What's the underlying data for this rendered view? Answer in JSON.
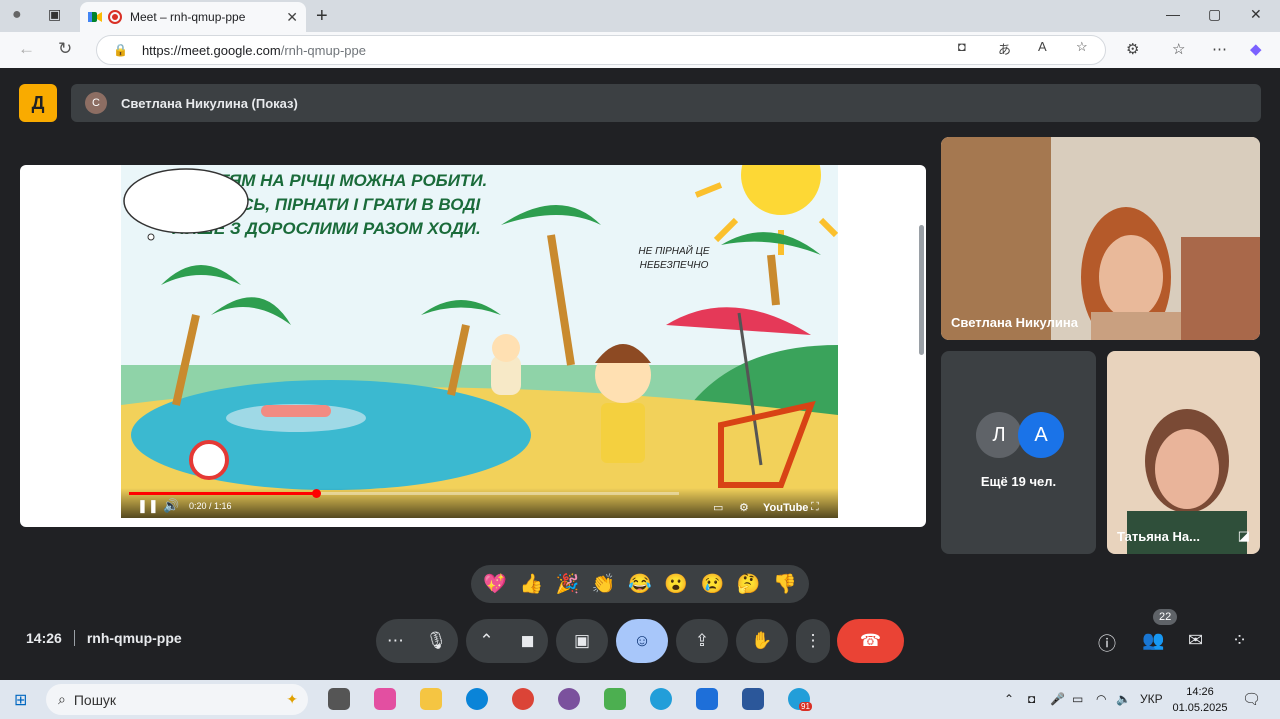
{
  "browser": {
    "tab_title": "Meet – rnh-qmup-ppe",
    "tab_close": "✕",
    "new_tab": "+",
    "url_host": "https://meet.google.com",
    "url_path": "/rnh-qmup-ppe",
    "win_min": "—",
    "win_max": "▢",
    "win_close": "✕"
  },
  "meet": {
    "logo_glyph": "Д",
    "presenter_initial": "С",
    "presenter_label": "Светлана Никулина (Показ)",
    "slide": {
      "caption_line1": "ЩО ДІТЯМ НА РІЧЦІ МОЖНА РОБИТИ.",
      "caption_line2": "КУПАТИСЬ, ПІРНАТИ І ГРАТИ В ВОДІ",
      "caption_line3": "ЛИШЕ З ДОРОСЛИМИ РАЗОМ ХОДИ.",
      "bubble_line1": "НЕ ПІРНАЙ ЦЕ",
      "bubble_line2": "НЕБЕЗПЕЧНО"
    },
    "player": {
      "time": "0:20 / 1:16",
      "progress": 0.34,
      "youtube_label": "YouTube"
    },
    "tiles": {
      "speaker_name": "Светлана Никулина",
      "others_initial_1": "Л",
      "others_initial_2": "А",
      "others_label": "Ещё 19 чел.",
      "tile3_name": "Татьяна На..."
    },
    "reactions": [
      "💖",
      "👍",
      "🎉",
      "👏",
      "😂",
      "😮",
      "😢",
      "🤔",
      "👎"
    ],
    "time": "14:26",
    "meeting_code": "rnh-qmup-ppe",
    "participant_count": "22"
  },
  "taskbar": {
    "search_placeholder": "Пошук",
    "lang": "УКР",
    "clock_time": "14:26",
    "clock_date": "01.05.2025",
    "telegram_badge": "91"
  },
  "colors": {
    "accent": "#a8c7fa",
    "end_call": "#ea4335",
    "presenting_logo": "#f9ab00"
  }
}
